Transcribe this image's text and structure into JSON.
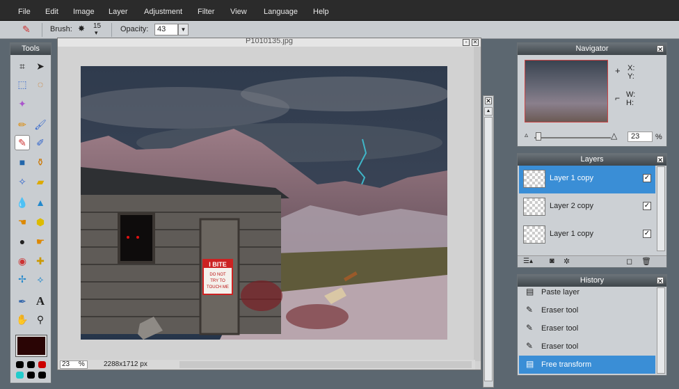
{
  "menu": [
    "File",
    "Edit",
    "Image",
    "Layer",
    "Adjustment",
    "Filter",
    "View",
    "Language",
    "Help"
  ],
  "options": {
    "brush_label": "Brush:",
    "brush_size": "15",
    "opacity_label": "Opacity:",
    "opacity_value": "43"
  },
  "tools_panel": {
    "title": "Tools"
  },
  "document": {
    "title": "P1010135.jpg",
    "zoom": "23",
    "zoom_unit": "%",
    "dimensions": "2288x1712 px",
    "sign_text": [
      "I BITE",
      "DO NOT",
      "TRY TO",
      "TOUCH ME"
    ]
  },
  "navigator": {
    "title": "Navigator",
    "x_label": "X:",
    "y_label": "Y:",
    "w_label": "W:",
    "h_label": "H:",
    "zoom": "23",
    "zoom_unit": "%"
  },
  "layers": {
    "title": "Layers",
    "items": [
      {
        "name": "Layer 1 copy",
        "selected": true,
        "visible": true
      },
      {
        "name": "Layer 2 copy",
        "selected": false,
        "visible": true
      },
      {
        "name": "Layer 1 copy",
        "selected": false,
        "visible": true
      }
    ]
  },
  "history": {
    "title": "History",
    "items": [
      {
        "label": "Paste layer",
        "icon": "paste-layer-icon"
      },
      {
        "label": "Eraser tool",
        "icon": "eraser-icon"
      },
      {
        "label": "Eraser tool",
        "icon": "eraser-icon"
      },
      {
        "label": "Eraser tool",
        "icon": "eraser-icon"
      },
      {
        "label": "Free transform",
        "icon": "transform-icon",
        "selected": true
      }
    ]
  },
  "colors": {
    "foreground": "#2a0505",
    "selection": "#3a8ed6"
  }
}
